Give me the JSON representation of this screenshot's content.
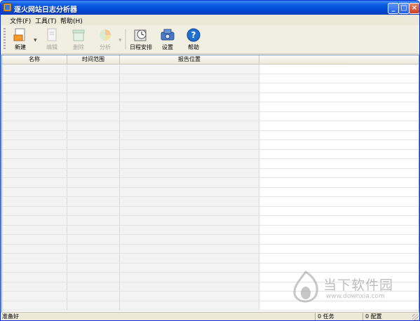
{
  "window": {
    "title": "逐火网站日志分析器",
    "controls": {
      "minimize": "_",
      "maximize": "□",
      "close": "×"
    }
  },
  "menu": [
    {
      "label": "文件(F)"
    },
    {
      "label": "工具(T)"
    },
    {
      "label": "帮助(H)"
    }
  ],
  "toolbar": [
    {
      "label": "新建",
      "icon": "new-document-icon",
      "enabled": true,
      "has_dropdown": true
    },
    {
      "label": "编辑",
      "icon": "edit-document-icon",
      "enabled": false
    },
    {
      "label": "删除",
      "icon": "delete-icon",
      "enabled": false
    },
    {
      "label": "分析",
      "icon": "pie-chart-icon",
      "enabled": false,
      "has_dropdown": true
    },
    {
      "label": "日程安排",
      "icon": "clock-icon",
      "enabled": true
    },
    {
      "label": "设置",
      "icon": "settings-icon",
      "enabled": true
    },
    {
      "label": "帮助",
      "icon": "help-icon",
      "enabled": true
    }
  ],
  "table": {
    "columns": [
      "名称",
      "时间范围",
      "报告位置",
      ""
    ],
    "rows": []
  },
  "status": {
    "message": "准备好",
    "tasks": "0 任务",
    "configs": "0 配置"
  },
  "watermark": {
    "title": "当下软件园",
    "url": "www.downxia.com"
  },
  "colors": {
    "titlebar": "#0a5be0",
    "chrome": "#ece9d8",
    "help_icon": "#1f6fd1"
  }
}
